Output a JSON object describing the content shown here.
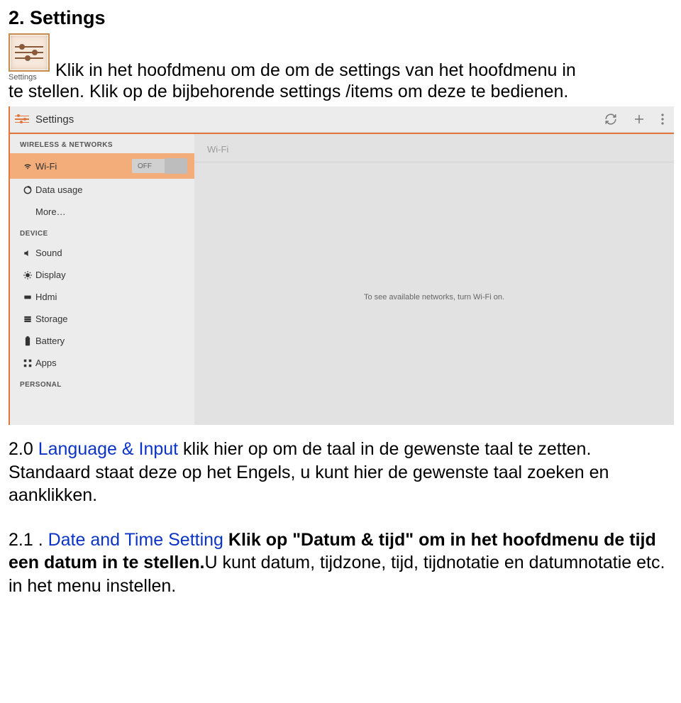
{
  "doc": {
    "heading": "2. Settings",
    "icon_label": "Settings",
    "intro_first": "Klik in het hoofdmenu om de om de settings van het hoofdmenu in",
    "intro_second": "te stellen. Klik op de bijbehorende settings /items om deze te bedienen."
  },
  "screenshot": {
    "header_title": "Settings",
    "sidebar": {
      "cat_wireless": "WIRELESS & NETWORKS",
      "wifi": "Wi-Fi",
      "wifi_toggle": "OFF",
      "data_usage": "Data usage",
      "more": "More…",
      "cat_device": "DEVICE",
      "sound": "Sound",
      "display": "Display",
      "hdmi": "Hdmi",
      "storage": "Storage",
      "battery": "Battery",
      "apps": "Apps",
      "cat_personal": "PERSONAL"
    },
    "panel": {
      "title": "Wi-Fi",
      "empty_msg": "To see available networks, turn Wi-Fi on."
    }
  },
  "p_lang": {
    "num": "2.0 ",
    "blue": "Language & Input",
    "rest1": " klik hier op om de taal in de gewenste taal te zetten. Standaard staat deze op het Engels, u kunt hier de gewenste taal zoeken en aanklikken."
  },
  "p_date": {
    "num": "2.1 . ",
    "blue": "Date and Time Setting",
    "bold1": " Klik op \"Datum & tijd\" om in het hoofdmenu de tijd een datum in te stellen.",
    "rest": "U kunt  datum, tijdzone, tijd, tijdnotatie en datumnotatie etc. in het menu instellen."
  }
}
